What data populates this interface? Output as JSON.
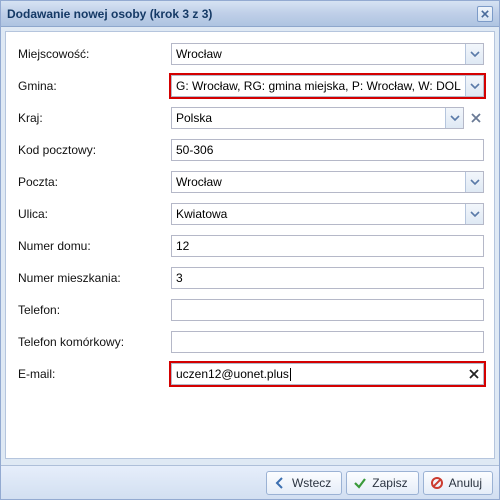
{
  "window": {
    "title": "Dodawanie nowej osoby (krok 3 z 3)"
  },
  "form": {
    "miejscowosc": {
      "label": "Miejscowość:",
      "value": "Wrocław"
    },
    "gmina": {
      "label": "Gmina:",
      "value": "G: Wrocław, RG: gmina miejska, P: Wrocław, W: DOLNOŚLĄSKIE"
    },
    "kraj": {
      "label": "Kraj:",
      "value": "Polska"
    },
    "kod_pocztowy": {
      "label": "Kod pocztowy:",
      "value": "50-306"
    },
    "poczta": {
      "label": "Poczta:",
      "value": "Wrocław"
    },
    "ulica": {
      "label": "Ulica:",
      "value": "Kwiatowa"
    },
    "numer_domu": {
      "label": "Numer domu:",
      "value": "12"
    },
    "numer_mieszkania": {
      "label": "Numer mieszkania:",
      "value": "3"
    },
    "telefon": {
      "label": "Telefon:",
      "value": ""
    },
    "telefon_kom": {
      "label": "Telefon komórkowy:",
      "value": ""
    },
    "email": {
      "label": "E-mail:",
      "value": "uczen12@uonet.plus"
    }
  },
  "buttons": {
    "back": "Wstecz",
    "save": "Zapisz",
    "cancel": "Anuluj"
  }
}
